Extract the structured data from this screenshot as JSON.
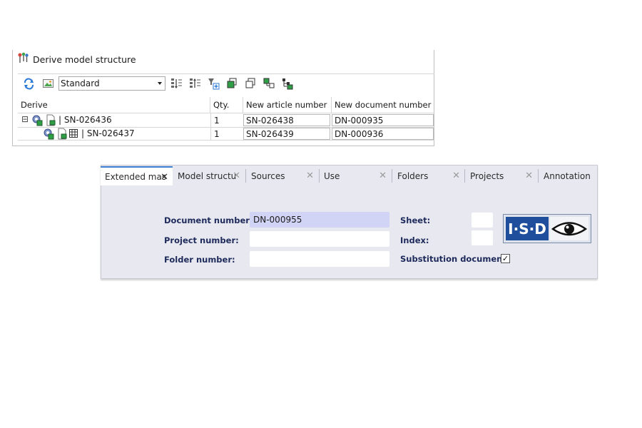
{
  "derive_panel": {
    "title": "Derive model structure",
    "view_select": {
      "value": "Standard"
    },
    "columns": [
      "Derive",
      "Qty.",
      "New article number",
      "New document number"
    ],
    "rows": [
      {
        "expand": "⊟",
        "name": "| SN-026436",
        "qty": "1",
        "new_article": "SN-026438",
        "new_document": "DN-000935"
      },
      {
        "expand": "",
        "name": "| SN-026437",
        "qty": "1",
        "new_article": "SN-026439",
        "new_document": "DN-000936"
      }
    ]
  },
  "extended_panel": {
    "tabs": [
      {
        "label": "Extended mas",
        "active": true
      },
      {
        "label": "Model structu"
      },
      {
        "label": "Sources"
      },
      {
        "label": "Use"
      },
      {
        "label": "Folders"
      },
      {
        "label": "Projects"
      },
      {
        "label": "Annotation"
      }
    ],
    "close_glyph": "✕",
    "fields": {
      "document_number": {
        "label": "Document number:",
        "value": "DN-000955"
      },
      "project_number": {
        "label": "Project number:",
        "value": ""
      },
      "folder_number": {
        "label": "Folder number:",
        "value": ""
      },
      "sheet": {
        "label": "Sheet:",
        "value": ""
      },
      "index": {
        "label": "Index:",
        "value": ""
      },
      "substitution_document": {
        "label": "Substitution document:",
        "checked": true,
        "check_glyph": "✓"
      }
    },
    "logo_text": "I·S·D"
  },
  "colors": {
    "tab_accent": "#3c7fd0",
    "panel_bg": "#e8e8f1",
    "label_text": "#1d2a5a",
    "active_field": "#d2d4f6",
    "logo_blue": "#1f4f9c"
  }
}
